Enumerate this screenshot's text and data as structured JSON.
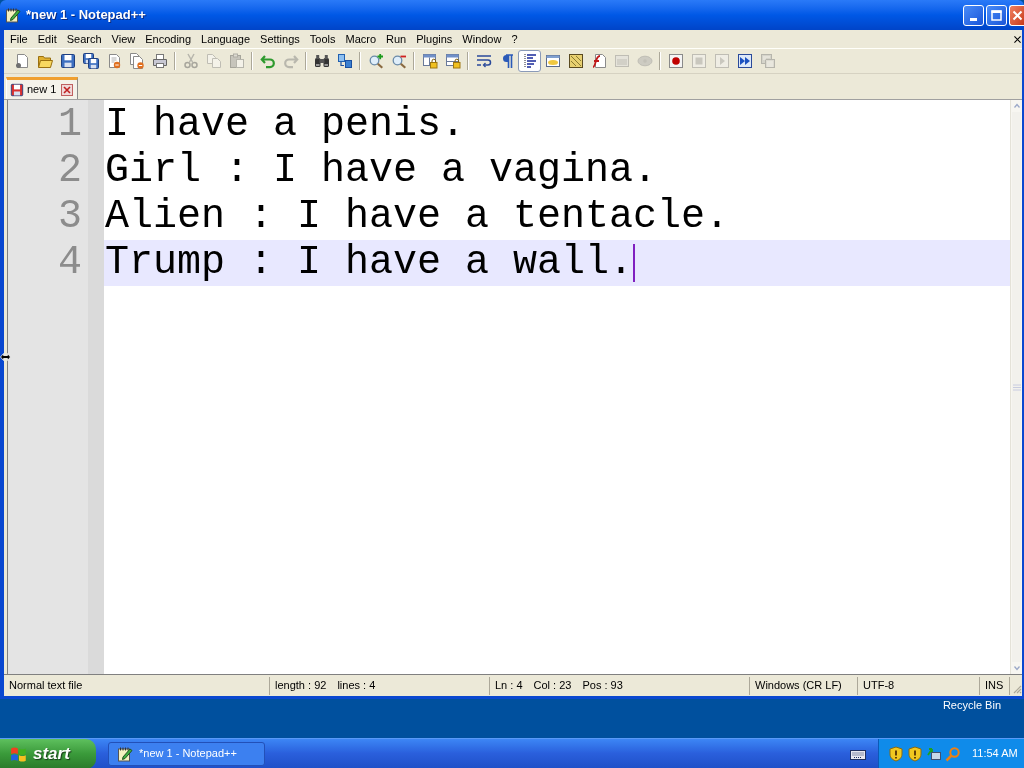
{
  "window": {
    "title": "*new 1 - Notepad++"
  },
  "menu": [
    "File",
    "Edit",
    "Search",
    "View",
    "Encoding",
    "Language",
    "Settings",
    "Tools",
    "Macro",
    "Run",
    "Plugins",
    "Window",
    "?"
  ],
  "toolbar": [
    [
      {
        "kind": "new",
        "disabled": false,
        "pressed": false
      },
      {
        "kind": "open",
        "disabled": false,
        "pressed": false
      },
      {
        "kind": "save",
        "disabled": false,
        "pressed": false
      },
      {
        "kind": "saveall",
        "disabled": false,
        "pressed": false
      },
      {
        "kind": "close",
        "disabled": false,
        "pressed": false
      },
      {
        "kind": "closeall",
        "disabled": false,
        "pressed": false
      },
      {
        "kind": "print",
        "disabled": false,
        "pressed": false
      }
    ],
    [
      {
        "kind": "cut",
        "disabled": true,
        "pressed": false
      },
      {
        "kind": "copy",
        "disabled": true,
        "pressed": false
      },
      {
        "kind": "paste",
        "disabled": true,
        "pressed": false
      }
    ],
    [
      {
        "kind": "undo",
        "disabled": false,
        "pressed": false
      },
      {
        "kind": "redo",
        "disabled": true,
        "pressed": false
      }
    ],
    [
      {
        "kind": "find",
        "disabled": false,
        "pressed": false
      },
      {
        "kind": "replace",
        "disabled": false,
        "pressed": false
      }
    ],
    [
      {
        "kind": "zoomin",
        "disabled": false,
        "pressed": false
      },
      {
        "kind": "zoomout",
        "disabled": false,
        "pressed": false
      }
    ],
    [
      {
        "kind": "syncv",
        "disabled": false,
        "pressed": false
      },
      {
        "kind": "synch",
        "disabled": false,
        "pressed": false
      }
    ],
    [
      {
        "kind": "wrap",
        "disabled": false,
        "pressed": false
      },
      {
        "kind": "allchars",
        "disabled": false,
        "pressed": false
      },
      {
        "kind": "indent",
        "disabled": false,
        "pressed": true
      },
      {
        "kind": "udl",
        "disabled": false,
        "pressed": false
      },
      {
        "kind": "docmap",
        "disabled": false,
        "pressed": false
      },
      {
        "kind": "funclist",
        "disabled": false,
        "pressed": false
      },
      {
        "kind": "folderws",
        "disabled": true,
        "pressed": false
      },
      {
        "kind": "monitor",
        "disabled": true,
        "pressed": false
      }
    ],
    [
      {
        "kind": "record",
        "disabled": false,
        "pressed": false
      },
      {
        "kind": "stop",
        "disabled": true,
        "pressed": false
      },
      {
        "kind": "play",
        "disabled": true,
        "pressed": false
      },
      {
        "kind": "playmulti",
        "disabled": false,
        "pressed": false
      },
      {
        "kind": "savemacro",
        "disabled": true,
        "pressed": false
      }
    ]
  ],
  "tabs": [
    {
      "label": "new 1",
      "selected": true,
      "modified": true
    }
  ],
  "editor": {
    "lines": [
      {
        "number": "1",
        "text": "I have a penis.",
        "current": false
      },
      {
        "number": "2",
        "text": "Girl : I have a vagina.",
        "current": false
      },
      {
        "number": "3",
        "text": "Alien : I have a tentacle.",
        "current": false
      },
      {
        "number": "4",
        "text": "Trump : I have a wall.",
        "current": true
      }
    ]
  },
  "status_bar": {
    "file_type": "Normal text file",
    "length": "length : 92",
    "lines": "lines : 4",
    "line": "Ln : 4",
    "column": "Col : 23",
    "position": "Pos : 93",
    "eol": "Windows (CR LF)",
    "encoding": "UTF-8",
    "mode": "INS"
  },
  "desktop": {
    "icon_label": "Recycle Bin"
  },
  "taskbar": {
    "start": "start",
    "tasks": [
      {
        "label": "*new 1 - Notepad++"
      }
    ],
    "clock": "11:54 AM"
  }
}
